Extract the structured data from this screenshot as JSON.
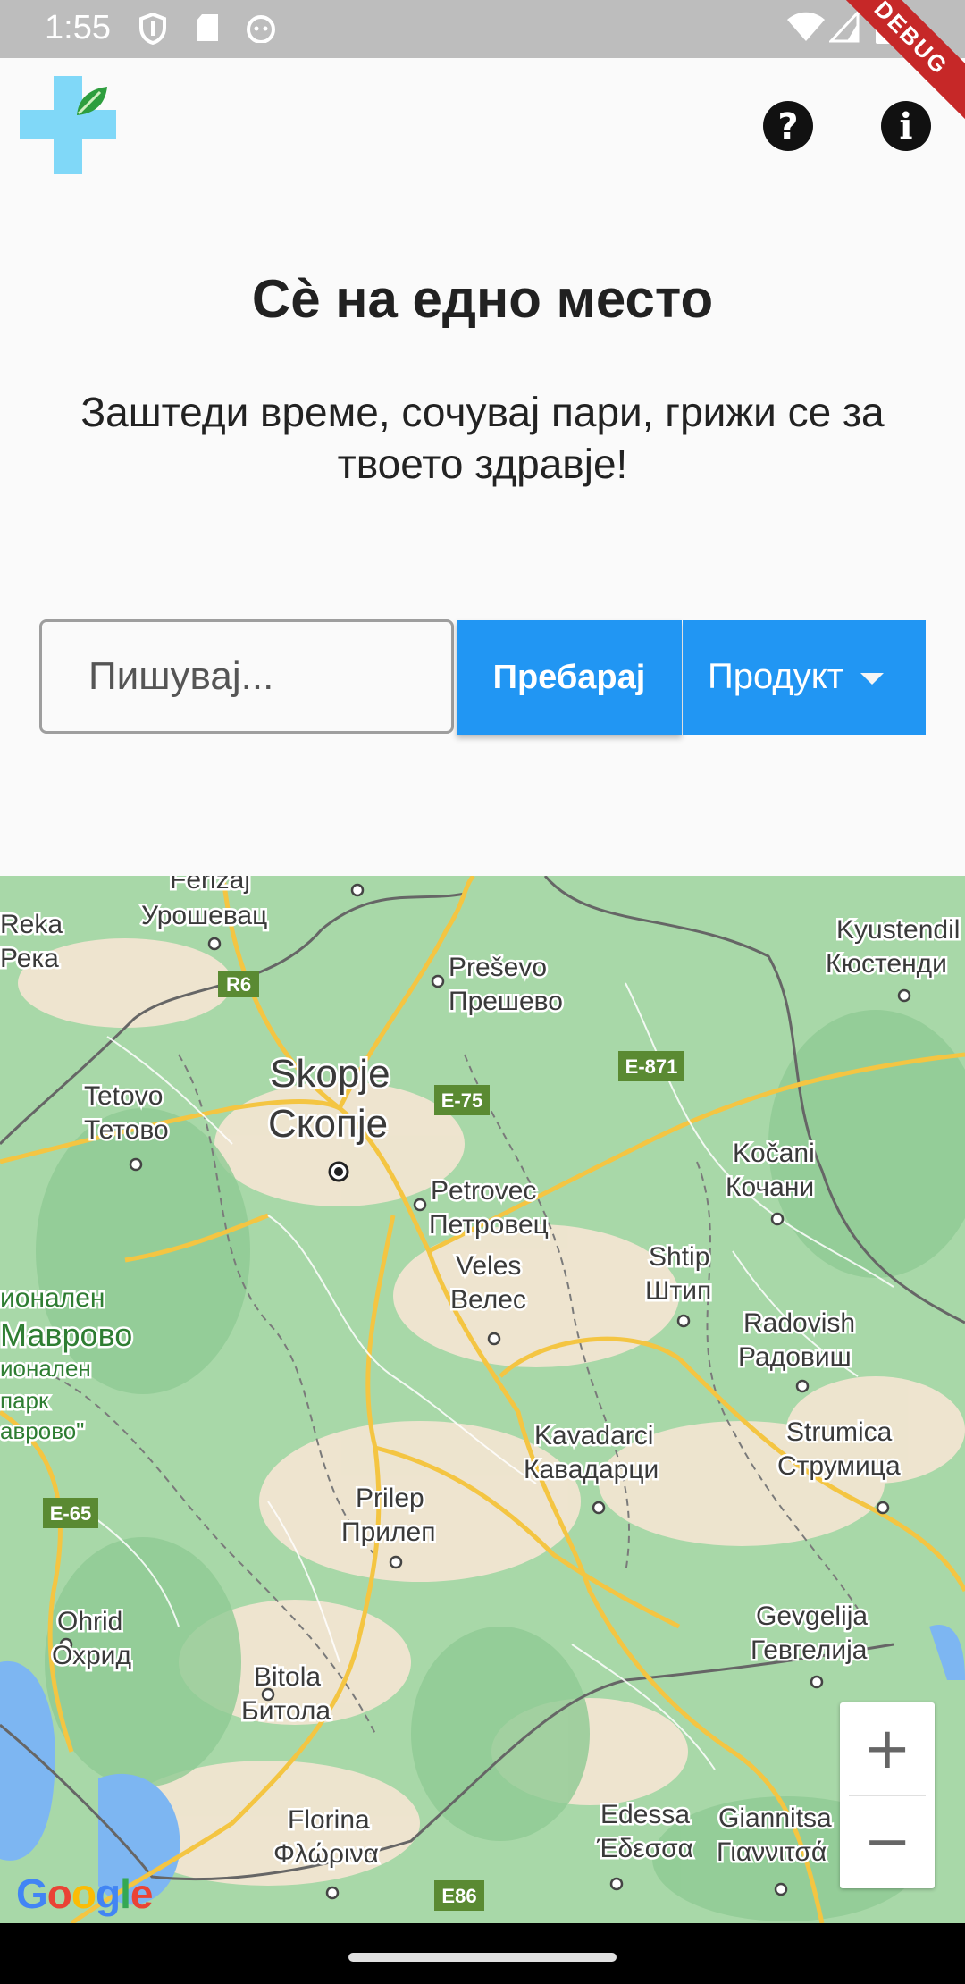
{
  "status_bar": {
    "time": "1:55",
    "left_icons": [
      "shield-icon",
      "sd-card-icon",
      "cat-face-icon"
    ],
    "right_icons": [
      "wifi-icon",
      "cell-signal-icon",
      "battery-icon"
    ]
  },
  "debug_banner": "DEBUG",
  "app_bar": {
    "logo": "medical-cross-leaf-logo",
    "help_icon_glyph": "?",
    "info_icon_glyph": "i"
  },
  "hero": {
    "title": "Сè на едно место",
    "subtitle": "Заштеди време, сочувај пари, грижи се за твоето здравје!"
  },
  "search": {
    "placeholder": "Пишувај...",
    "button_label": "Пребарај",
    "type_selected": "Продукт"
  },
  "map": {
    "labels": [
      {
        "text": "Ferizaj",
        "name": "map-label-ferizaj"
      },
      {
        "text": "Урошевац",
        "name": "map-label-urosevac"
      },
      {
        "text": "Reka",
        "name": "map-label-reka"
      },
      {
        "text": "Река",
        "name": "map-label-reka-cyr"
      },
      {
        "text": "Preševo",
        "name": "map-label-presevo"
      },
      {
        "text": "Прешево",
        "name": "map-label-presevo-cyr"
      },
      {
        "text": "Kyustendil",
        "name": "map-label-kyustendil"
      },
      {
        "text": "Кюстенди",
        "name": "map-label-kyustendil-cyr"
      },
      {
        "text": "Skopje",
        "name": "map-label-skopje"
      },
      {
        "text": "Скопје",
        "name": "map-label-skopje-cyr"
      },
      {
        "text": "Tetovo",
        "name": "map-label-tetovo"
      },
      {
        "text": "Тетово",
        "name": "map-label-tetovo-cyr"
      },
      {
        "text": "Petrovec",
        "name": "map-label-petrovec"
      },
      {
        "text": "Петровец",
        "name": "map-label-petrovec-cyr"
      },
      {
        "text": "Kočani",
        "name": "map-label-kocani"
      },
      {
        "text": "Кочани",
        "name": "map-label-kocani-cyr"
      },
      {
        "text": "Veles",
        "name": "map-label-veles"
      },
      {
        "text": "Велес",
        "name": "map-label-veles-cyr"
      },
      {
        "text": "Shtip",
        "name": "map-label-shtip"
      },
      {
        "text": "Штип",
        "name": "map-label-shtip-cyr"
      },
      {
        "text": "ионален",
        "name": "map-label-park-1"
      },
      {
        "text": "Маврово",
        "name": "map-label-mavrovo"
      },
      {
        "text": "ионален",
        "name": "map-label-park-2"
      },
      {
        "text": "парк",
        "name": "map-label-park-3"
      },
      {
        "text": "аврово\"",
        "name": "map-label-park-4"
      },
      {
        "text": "Radovish",
        "name": "map-label-radovish"
      },
      {
        "text": "Радовиш",
        "name": "map-label-radovish-cyr"
      },
      {
        "text": "Kavadarci",
        "name": "map-label-kavadarci"
      },
      {
        "text": "Кавадарци",
        "name": "map-label-kavadarci-cyr"
      },
      {
        "text": "Strumica",
        "name": "map-label-strumica"
      },
      {
        "text": "Струмица",
        "name": "map-label-strumica-cyr"
      },
      {
        "text": "Prilep",
        "name": "map-label-prilep"
      },
      {
        "text": "Прилеп",
        "name": "map-label-prilep-cyr"
      },
      {
        "text": "Ohrid",
        "name": "map-label-ohrid"
      },
      {
        "text": "Охрид",
        "name": "map-label-ohrid-cyr"
      },
      {
        "text": "Gevgelija",
        "name": "map-label-gevgelija"
      },
      {
        "text": "Гевгелија",
        "name": "map-label-gevgelija-cyr"
      },
      {
        "text": "Bitola",
        "name": "map-label-bitola"
      },
      {
        "text": "Битола",
        "name": "map-label-bitola-cyr"
      },
      {
        "text": "Edessa",
        "name": "map-label-edessa"
      },
      {
        "text": "Έδεσσα",
        "name": "map-label-edessa-gr"
      },
      {
        "text": "Giannitsa",
        "name": "map-label-giannitsa"
      },
      {
        "text": "Γιαννιτσά",
        "name": "map-label-giannitsa-gr"
      },
      {
        "text": "Florina",
        "name": "map-label-florina"
      },
      {
        "text": "Φλώρινα",
        "name": "map-label-florina-gr"
      }
    ],
    "shields": [
      {
        "text": "R6",
        "name": "road-shield-r6"
      },
      {
        "text": "E-871",
        "name": "road-shield-e871"
      },
      {
        "text": "E-75",
        "name": "road-shield-e75"
      },
      {
        "text": "E-65",
        "name": "road-shield-e65"
      },
      {
        "text": "E86",
        "name": "road-shield-e86"
      }
    ],
    "zoom_in": "+",
    "zoom_out": "−",
    "attribution": [
      "G",
      "o",
      "o",
      "g",
      "l",
      "e"
    ],
    "attribution_colors": [
      "#4285F4",
      "#EA4335",
      "#FBBC05",
      "#4285F4",
      "#34A853",
      "#EA4335"
    ]
  }
}
